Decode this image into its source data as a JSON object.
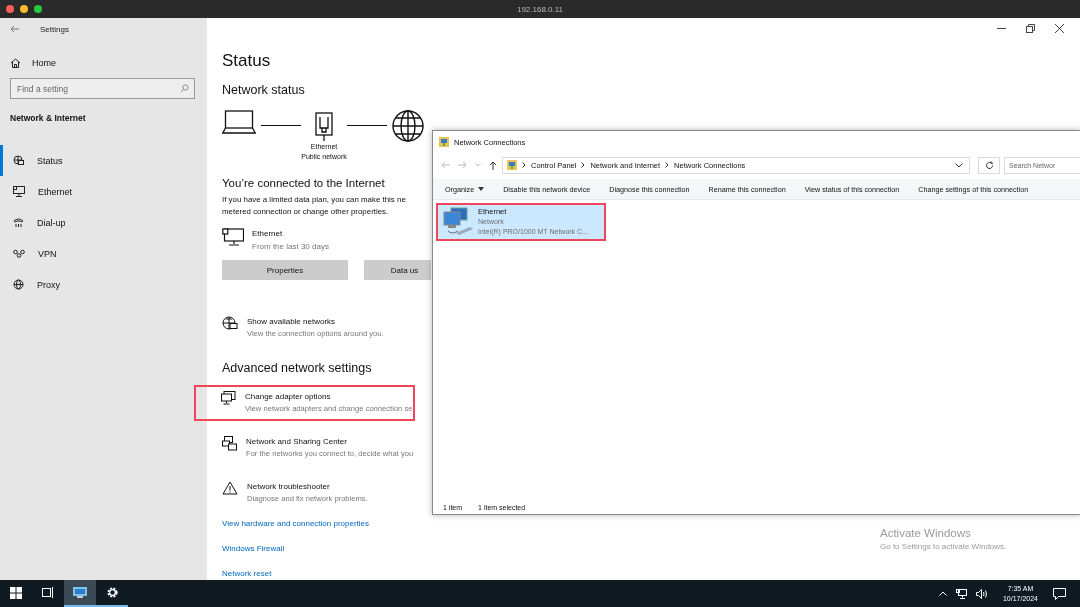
{
  "remote_window": {
    "title": "192.168.0.11"
  },
  "settings": {
    "title": "Settings",
    "home": "Home",
    "search": {
      "placeholder": "Find a setting"
    },
    "section": "Network & Internet",
    "nav": [
      {
        "label": "Status",
        "kind": "status",
        "selected": true
      },
      {
        "label": "Ethernet",
        "kind": "ethernet",
        "selected": false
      },
      {
        "label": "Dial-up",
        "kind": "dialup",
        "selected": false
      },
      {
        "label": "VPN",
        "kind": "vpn",
        "selected": false
      },
      {
        "label": "Proxy",
        "kind": "proxy",
        "selected": false
      }
    ],
    "page_title": "Status",
    "network_status": "Network status",
    "diagram": {
      "adapter": "Ethernet",
      "network": "Public network"
    },
    "connected": {
      "heading": "You’re connected to the Internet",
      "lines": [
        "If you have a limited data plan, you can make this ne",
        "metered connection or change other properties."
      ]
    },
    "usage": {
      "name": "Ethernet",
      "period": "From the last 30 days"
    },
    "buttons": [
      "Properties",
      "Data us"
    ],
    "options": [
      {
        "kind": "networks",
        "title": "Show available networks",
        "description": "View the connection options around you.",
        "highlighted": false
      }
    ],
    "advanced_heading": "Advanced network settings",
    "advanced": [
      {
        "kind": "adapter",
        "title": "Change adapter options",
        "description": "View network adapters and change connection se",
        "highlighted": true
      },
      {
        "kind": "sharing",
        "title": "Network and Sharing Center",
        "description": "For the networks you connect to, decide what you",
        "highlighted": false
      },
      {
        "kind": "troubleshooter",
        "title": "Network troubleshooter",
        "description": "Diagnose and fix network problems.",
        "highlighted": false
      }
    ],
    "links": [
      "View hardware and connection properties",
      "Windows Firewall",
      "Network reset"
    ]
  },
  "network_connections": {
    "title": "Network Connections",
    "breadcrumbs": [
      "Control Panel",
      "Network and Internet",
      "Network Connections"
    ],
    "search": {
      "placeholder": "Search Networ"
    },
    "commands": [
      {
        "label": "Organize",
        "menu": true
      },
      {
        "label": "Disable this network device",
        "menu": false
      },
      {
        "label": "Diagnose this connection",
        "menu": false
      },
      {
        "label": "Rename this connection",
        "menu": false
      },
      {
        "label": "View status of this connection",
        "menu": false
      },
      {
        "label": "Change settings of this connection",
        "menu": false
      }
    ],
    "items": [
      {
        "name": "Ethernet",
        "network": "Network",
        "device": "Intel(R) PRO/1000 MT Network C...",
        "selected": true,
        "highlighted": true
      }
    ],
    "status_bar": [
      "1 item",
      "1 item selected"
    ]
  },
  "activation": {
    "title": "Activate Windows",
    "text": "Go to Settings to activate Windows."
  },
  "taskbar": {
    "apps": [
      {
        "kind": "start",
        "focused": false,
        "running": false
      },
      {
        "kind": "task-view",
        "focused": false,
        "running": false
      },
      {
        "kind": "network-connections",
        "focused": true,
        "running": true
      },
      {
        "kind": "settings",
        "focused": false,
        "running": true
      }
    ],
    "time": "7:35 AM",
    "date": "10/17/2024"
  }
}
